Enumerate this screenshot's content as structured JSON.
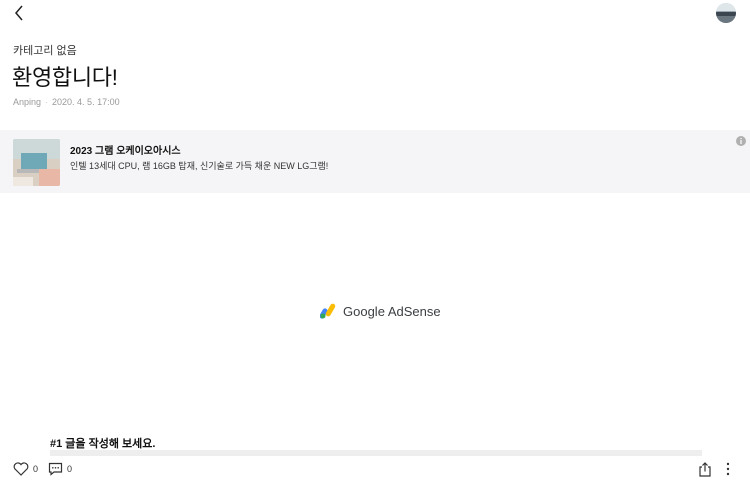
{
  "header": {
    "back_icon": "chevron-left-icon",
    "avatar_icon": "profile-avatar"
  },
  "post": {
    "category": "카테고리 없음",
    "title": "환영합니다!",
    "author": "Anping",
    "date": "2020. 4. 5. 17:00"
  },
  "ad": {
    "title": "2023 그램 오케이오아시스",
    "description": "인텔 13세대 CPU, 램 16GB 탑재, 신기술로 가득 채운 NEW LG그램!",
    "info_icon": "info-icon"
  },
  "adsense": {
    "label": "Google AdSense"
  },
  "content": {
    "heading": "#1 글을 작성해 보세요."
  },
  "bottom_bar": {
    "like_count": "0",
    "comment_count": "0",
    "share_icon": "share-icon",
    "more_icon": "more-vertical-icon"
  }
}
